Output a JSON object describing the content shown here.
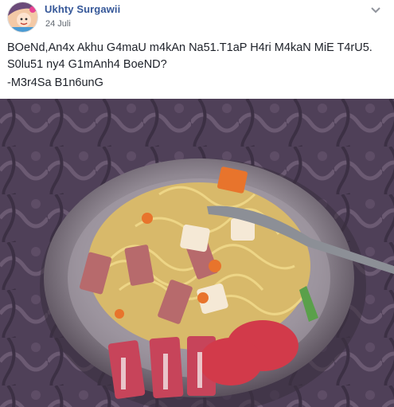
{
  "post": {
    "author": "Ukhty Surgawii",
    "date": "24 Juli",
    "text_line1": "BOeNd,An4x Akhu G4maU m4kAn Na51.T1aP H4ri M4kaN MiE T4rU5.",
    "text_line2": "S0lu51 ny4 G1mAnh4 BoeND?",
    "signature": "-M3r4Sa B1n6unG"
  },
  "icons": {
    "options": "chevron-down-icon",
    "avatar": "cartoon-avatar"
  },
  "colors": {
    "author_link": "#365899",
    "date_text": "#606770",
    "body_text": "#1d2129"
  }
}
